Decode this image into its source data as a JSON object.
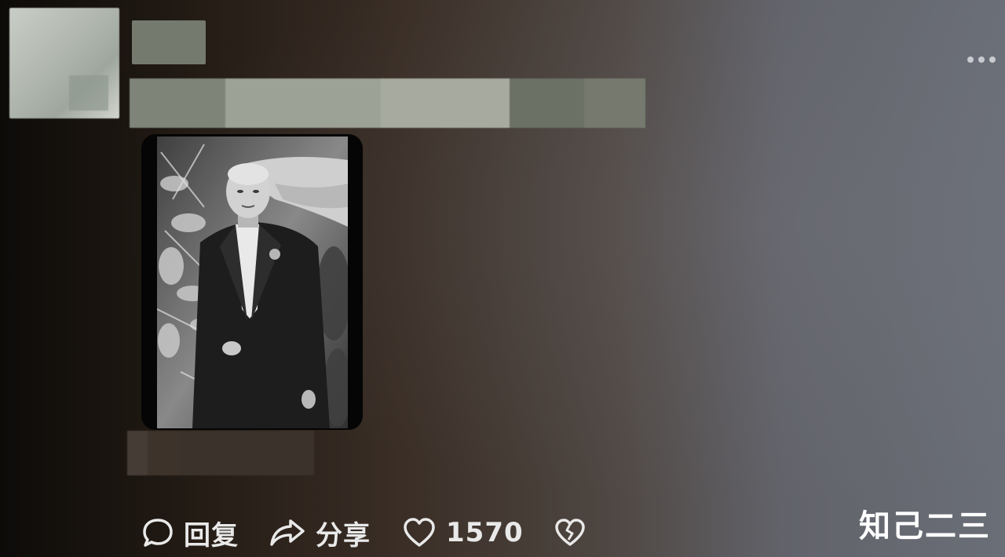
{
  "post": {
    "more_icon": "more-horizontal-icon",
    "photo_description_icon": "portrait-photo"
  },
  "actions": {
    "reply_label": "回复",
    "share_label": "分享",
    "like_count": "1570",
    "icons": [
      "comment-icon",
      "share-arrow-icon",
      "heart-icon",
      "broken-heart-icon"
    ]
  },
  "watermark": "知己二三",
  "colors": {
    "text": "#e9e9e9",
    "background_left": "#0d0b09",
    "background_right": "#6a6e77"
  }
}
